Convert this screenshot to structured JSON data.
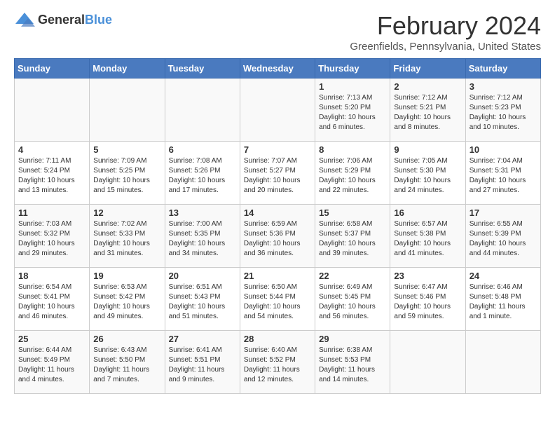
{
  "logo": {
    "general": "General",
    "blue": "Blue"
  },
  "title": "February 2024",
  "subtitle": "Greenfields, Pennsylvania, United States",
  "headers": [
    "Sunday",
    "Monday",
    "Tuesday",
    "Wednesday",
    "Thursday",
    "Friday",
    "Saturday"
  ],
  "weeks": [
    [
      {
        "day": "",
        "info": ""
      },
      {
        "day": "",
        "info": ""
      },
      {
        "day": "",
        "info": ""
      },
      {
        "day": "",
        "info": ""
      },
      {
        "day": "1",
        "info": "Sunrise: 7:13 AM\nSunset: 5:20 PM\nDaylight: 10 hours\nand 6 minutes."
      },
      {
        "day": "2",
        "info": "Sunrise: 7:12 AM\nSunset: 5:21 PM\nDaylight: 10 hours\nand 8 minutes."
      },
      {
        "day": "3",
        "info": "Sunrise: 7:12 AM\nSunset: 5:23 PM\nDaylight: 10 hours\nand 10 minutes."
      }
    ],
    [
      {
        "day": "4",
        "info": "Sunrise: 7:11 AM\nSunset: 5:24 PM\nDaylight: 10 hours\nand 13 minutes."
      },
      {
        "day": "5",
        "info": "Sunrise: 7:09 AM\nSunset: 5:25 PM\nDaylight: 10 hours\nand 15 minutes."
      },
      {
        "day": "6",
        "info": "Sunrise: 7:08 AM\nSunset: 5:26 PM\nDaylight: 10 hours\nand 17 minutes."
      },
      {
        "day": "7",
        "info": "Sunrise: 7:07 AM\nSunset: 5:27 PM\nDaylight: 10 hours\nand 20 minutes."
      },
      {
        "day": "8",
        "info": "Sunrise: 7:06 AM\nSunset: 5:29 PM\nDaylight: 10 hours\nand 22 minutes."
      },
      {
        "day": "9",
        "info": "Sunrise: 7:05 AM\nSunset: 5:30 PM\nDaylight: 10 hours\nand 24 minutes."
      },
      {
        "day": "10",
        "info": "Sunrise: 7:04 AM\nSunset: 5:31 PM\nDaylight: 10 hours\nand 27 minutes."
      }
    ],
    [
      {
        "day": "11",
        "info": "Sunrise: 7:03 AM\nSunset: 5:32 PM\nDaylight: 10 hours\nand 29 minutes."
      },
      {
        "day": "12",
        "info": "Sunrise: 7:02 AM\nSunset: 5:33 PM\nDaylight: 10 hours\nand 31 minutes."
      },
      {
        "day": "13",
        "info": "Sunrise: 7:00 AM\nSunset: 5:35 PM\nDaylight: 10 hours\nand 34 minutes."
      },
      {
        "day": "14",
        "info": "Sunrise: 6:59 AM\nSunset: 5:36 PM\nDaylight: 10 hours\nand 36 minutes."
      },
      {
        "day": "15",
        "info": "Sunrise: 6:58 AM\nSunset: 5:37 PM\nDaylight: 10 hours\nand 39 minutes."
      },
      {
        "day": "16",
        "info": "Sunrise: 6:57 AM\nSunset: 5:38 PM\nDaylight: 10 hours\nand 41 minutes."
      },
      {
        "day": "17",
        "info": "Sunrise: 6:55 AM\nSunset: 5:39 PM\nDaylight: 10 hours\nand 44 minutes."
      }
    ],
    [
      {
        "day": "18",
        "info": "Sunrise: 6:54 AM\nSunset: 5:41 PM\nDaylight: 10 hours\nand 46 minutes."
      },
      {
        "day": "19",
        "info": "Sunrise: 6:53 AM\nSunset: 5:42 PM\nDaylight: 10 hours\nand 49 minutes."
      },
      {
        "day": "20",
        "info": "Sunrise: 6:51 AM\nSunset: 5:43 PM\nDaylight: 10 hours\nand 51 minutes."
      },
      {
        "day": "21",
        "info": "Sunrise: 6:50 AM\nSunset: 5:44 PM\nDaylight: 10 hours\nand 54 minutes."
      },
      {
        "day": "22",
        "info": "Sunrise: 6:49 AM\nSunset: 5:45 PM\nDaylight: 10 hours\nand 56 minutes."
      },
      {
        "day": "23",
        "info": "Sunrise: 6:47 AM\nSunset: 5:46 PM\nDaylight: 10 hours\nand 59 minutes."
      },
      {
        "day": "24",
        "info": "Sunrise: 6:46 AM\nSunset: 5:48 PM\nDaylight: 11 hours\nand 1 minute."
      }
    ],
    [
      {
        "day": "25",
        "info": "Sunrise: 6:44 AM\nSunset: 5:49 PM\nDaylight: 11 hours\nand 4 minutes."
      },
      {
        "day": "26",
        "info": "Sunrise: 6:43 AM\nSunset: 5:50 PM\nDaylight: 11 hours\nand 7 minutes."
      },
      {
        "day": "27",
        "info": "Sunrise: 6:41 AM\nSunset: 5:51 PM\nDaylight: 11 hours\nand 9 minutes."
      },
      {
        "day": "28",
        "info": "Sunrise: 6:40 AM\nSunset: 5:52 PM\nDaylight: 11 hours\nand 12 minutes."
      },
      {
        "day": "29",
        "info": "Sunrise: 6:38 AM\nSunset: 5:53 PM\nDaylight: 11 hours\nand 14 minutes."
      },
      {
        "day": "",
        "info": ""
      },
      {
        "day": "",
        "info": ""
      }
    ]
  ]
}
